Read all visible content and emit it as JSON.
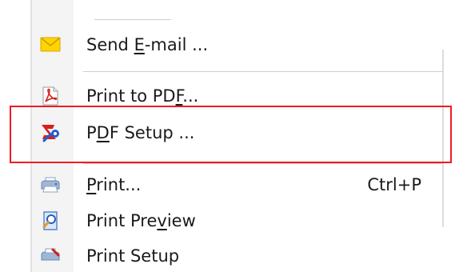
{
  "menu": {
    "items": [
      {
        "id": "send-email",
        "label_before": "Send ",
        "mnemonic": "E",
        "label_after": "-mail ...",
        "icon": "envelope-icon"
      },
      {
        "id": "print-to-pdf",
        "label_before": "Print to PD",
        "mnemonic": "F",
        "label_after": "...",
        "icon": "pdf-document-icon"
      },
      {
        "id": "pdf-setup",
        "label_before": "P",
        "mnemonic": "D",
        "label_after": "F Setup ...",
        "icon": "pdf-setup-icon"
      },
      {
        "id": "print",
        "label_before": "",
        "mnemonic": "P",
        "label_after": "rint...",
        "shortcut": "Ctrl+P",
        "icon": "printer-icon"
      },
      {
        "id": "print-preview",
        "label_before": "Print Pre",
        "mnemonic": "v",
        "label_after": "iew",
        "icon": "print-preview-icon"
      },
      {
        "id": "print-setup",
        "label_before": "Print Setup",
        "mnemonic": "",
        "label_after": "",
        "icon": "print-setup-icon"
      }
    ]
  },
  "colors": {
    "highlight_border": "#ee1c24",
    "envelope": "#ffd400",
    "pdf_red": "#d4201c",
    "setup_blue": "#1f5fd1"
  }
}
